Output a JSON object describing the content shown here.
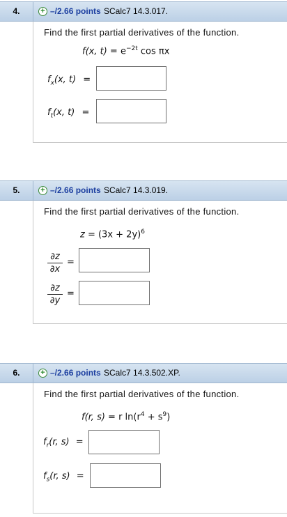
{
  "questions": [
    {
      "number": "4.",
      "points": "–/2.66 points",
      "source": "SCalc7 14.3.017.",
      "prompt": "Find the first partial derivatives of the function.",
      "function": {
        "lhs": "f(x, t)",
        "eq": " = e",
        "exp": "−2t",
        "rest": " cos πx"
      },
      "answers": [
        {
          "label_main": "f",
          "label_sub": "x",
          "label_args": "(x, t)",
          "equals": "=",
          "value": ""
        },
        {
          "label_main": "f",
          "label_sub": "t",
          "label_args": "(x, t)",
          "equals": "=",
          "value": ""
        }
      ]
    },
    {
      "number": "5.",
      "points": "–/2.66 points",
      "source": "SCalc7 14.3.019.",
      "prompt": "Find the first partial derivatives of the function.",
      "function": {
        "lhs": "z",
        "eq": " = (3x + 2y)",
        "exp": "6"
      },
      "answers": [
        {
          "num": "∂z",
          "den": "∂x",
          "equals": "=",
          "value": ""
        },
        {
          "num": "∂z",
          "den": "∂y",
          "equals": "=",
          "value": ""
        }
      ]
    },
    {
      "number": "6.",
      "points": "–/2.66 points",
      "source": "SCalc7 14.3.502.XP.",
      "prompt": "Find the first partial derivatives of the function.",
      "function": {
        "lhs": "f(r, s)",
        "eq": " = r ln(r",
        "exp1": "4",
        "mid": " + s",
        "exp2": "9",
        "end": ")"
      },
      "answers": [
        {
          "label_main": "f",
          "label_sub": "r",
          "label_args": "(r, s)",
          "equals": "=",
          "value": ""
        },
        {
          "label_main": "f",
          "label_sub": "s",
          "label_args": "(r, s)",
          "equals": "=",
          "value": ""
        }
      ]
    }
  ],
  "colors": {
    "header_bg": "#c9daec",
    "points_text": "#1c3fa0",
    "plus_icon": "#2e8b2e"
  }
}
